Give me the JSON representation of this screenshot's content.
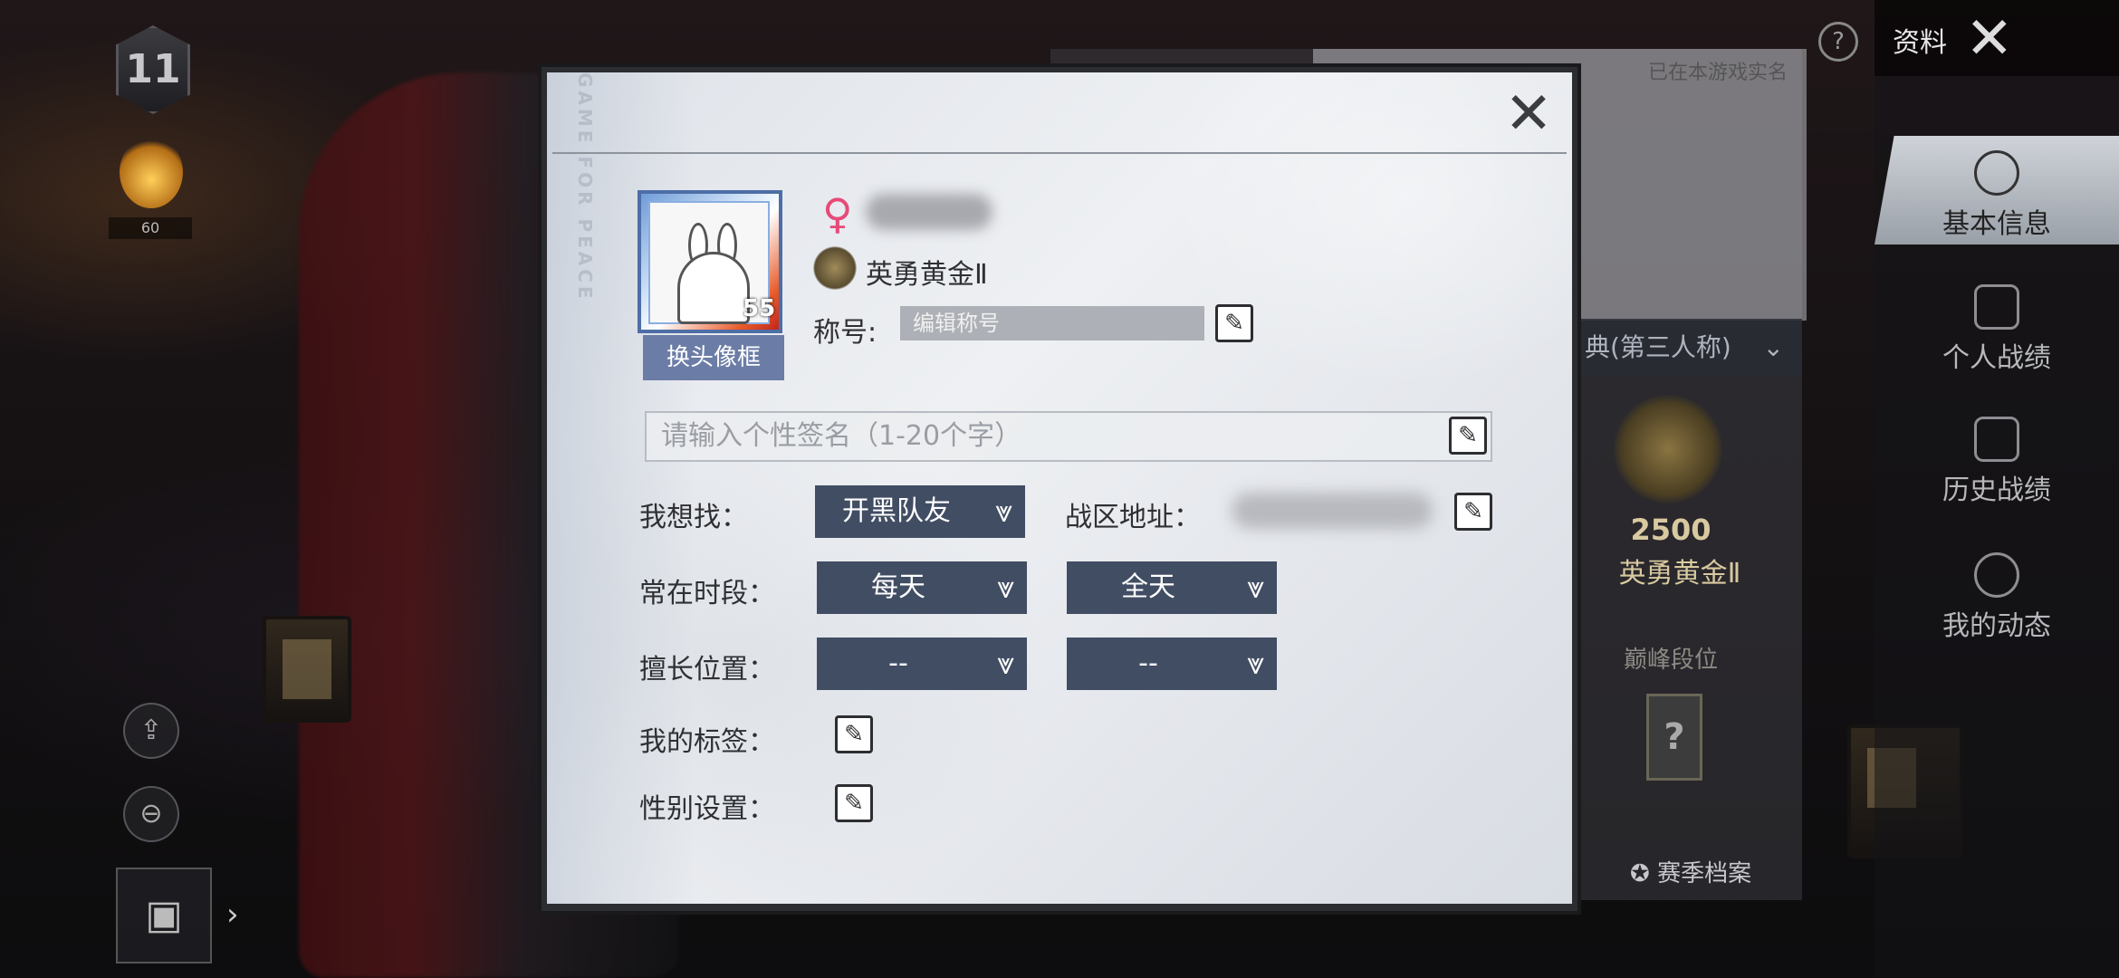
{
  "hud": {
    "rank_number": "11",
    "flame_value": "60"
  },
  "right_panel": {
    "top_label": "资料",
    "realname_note": "已在本游戏实名",
    "mode_label": "典(第三人称)",
    "score": "2500",
    "tier": "英勇黄金Ⅱ",
    "peak_label": "巅峰段位",
    "season_button": "赛季档案",
    "nav": [
      {
        "label": "基本信息",
        "icon": "profile-icon",
        "active": true
      },
      {
        "label": "个人战绩",
        "icon": "stats-icon"
      },
      {
        "label": "历史战绩",
        "icon": "history-icon"
      },
      {
        "label": "我的动态",
        "icon": "feed-icon"
      }
    ]
  },
  "modal": {
    "watermark": "GAME FOR PEACE",
    "avatar_level": "55",
    "change_frame_label": "换头像框",
    "gender_symbol": "♀",
    "gender_color": "#e64b78",
    "tier_name": "英勇黄金Ⅱ",
    "title_label": "称号:",
    "title_placeholder": "编辑称号",
    "signature_placeholder": "请输入个性签名（1-20个字）",
    "looking_for_label": "我想找：",
    "looking_for_value": "开黑队友",
    "region_label": "战区地址：",
    "active_time_label": "常在时段：",
    "active_time_days": "每天",
    "active_time_hours": "全天",
    "position_label": "擅长位置：",
    "position_primary": "--",
    "position_secondary": "--",
    "tags_label": "我的标签：",
    "gender_setting_label": "性别设置："
  },
  "colors": {
    "dropdown_bg": "#414d63",
    "frame_button_bg": "#6b7da7"
  }
}
